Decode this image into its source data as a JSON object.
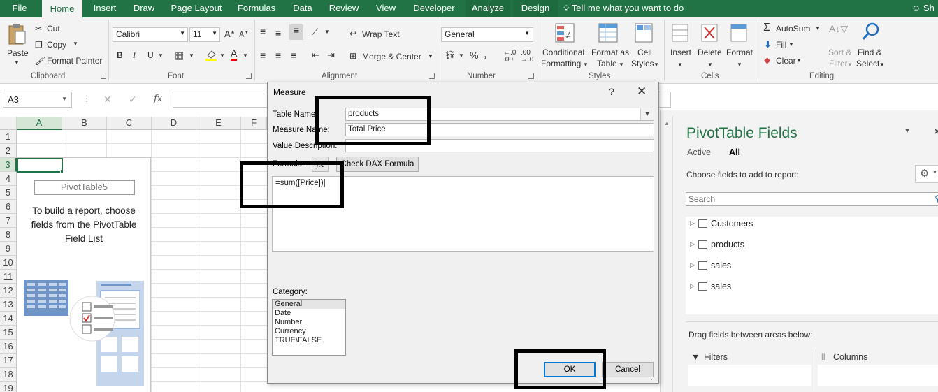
{
  "ribbon_tabs": [
    "File",
    "Home",
    "Insert",
    "Draw",
    "Page Layout",
    "Formulas",
    "Data",
    "Review",
    "View",
    "Developer",
    "Analyze",
    "Design"
  ],
  "tell_me": "Tell me what you want to do",
  "user_initials": "Sh",
  "clipboard": {
    "paste": "Paste",
    "cut": "Cut",
    "copy": "Copy",
    "format_painter": "Format Painter",
    "label": "Clipboard"
  },
  "font": {
    "name": "Calibri",
    "size": "11",
    "bold": "B",
    "italic": "I",
    "underline": "U",
    "label": "Font"
  },
  "alignment": {
    "wrap_text": "Wrap Text",
    "merge_center": "Merge & Center",
    "label": "Alignment"
  },
  "number": {
    "format": "General",
    "label": "Number"
  },
  "styles": {
    "conditional": "Conditional",
    "formatting": "Formatting",
    "format_as": "Format as",
    "table": "Table",
    "cell": "Cell",
    "cell_styles": "Styles",
    "label": "Styles"
  },
  "cells": {
    "insert": "Insert",
    "delete": "Delete",
    "format": "Format",
    "label": "Cells"
  },
  "editing": {
    "autosum": "AutoSum",
    "fill": "Fill",
    "clear": "Clear",
    "sort": "Sort &",
    "filter": "Filter",
    "find": "Find &",
    "select": "Select",
    "label": "Editing"
  },
  "name_box": "A3",
  "fx_symbol": "fx",
  "columns": [
    "A",
    "B",
    "C",
    "D",
    "E",
    "F"
  ],
  "rows": [
    "1",
    "2",
    "3",
    "4",
    "5",
    "6",
    "7",
    "8",
    "9",
    "10",
    "11",
    "12",
    "13",
    "14",
    "15",
    "16",
    "17",
    "18",
    "19"
  ],
  "pivot_placeholder": {
    "name": "PivotTable5",
    "text": "To build a report, choose fields from the PivotTable Field List"
  },
  "dialog": {
    "title": "Measure",
    "help": "?",
    "close": "✕",
    "table_name_label": "Table Name:",
    "table_name_value": "products",
    "measure_name_label": "Measure Name:",
    "measure_name_value": "Total Price",
    "value_desc_label": "Value Description:",
    "value_desc_value": "",
    "formula_label": "Formula:",
    "fx_button": "fx",
    "check_dax": "Check DAX Formula",
    "formula": "=sum([Price])",
    "category_label": "Category:",
    "categories": [
      "General",
      "Date",
      "Number",
      "Currency",
      "TRUE\\FALSE"
    ],
    "ok": "OK",
    "cancel": "Cancel"
  },
  "pane": {
    "title": "PivotTable Fields",
    "tab_active": "Active",
    "tab_all": "All",
    "subtitle": "Choose fields to add to report:",
    "search_placeholder": "Search",
    "fields": [
      "Customers",
      "products",
      "sales",
      "sales"
    ],
    "drag_text": "Drag fields between areas below:",
    "filters": "Filters",
    "columns": "Columns"
  },
  "colors": {
    "excel_green": "#217346",
    "ribbon_bg": "#f3f3f3",
    "annotation": "#000000"
  }
}
